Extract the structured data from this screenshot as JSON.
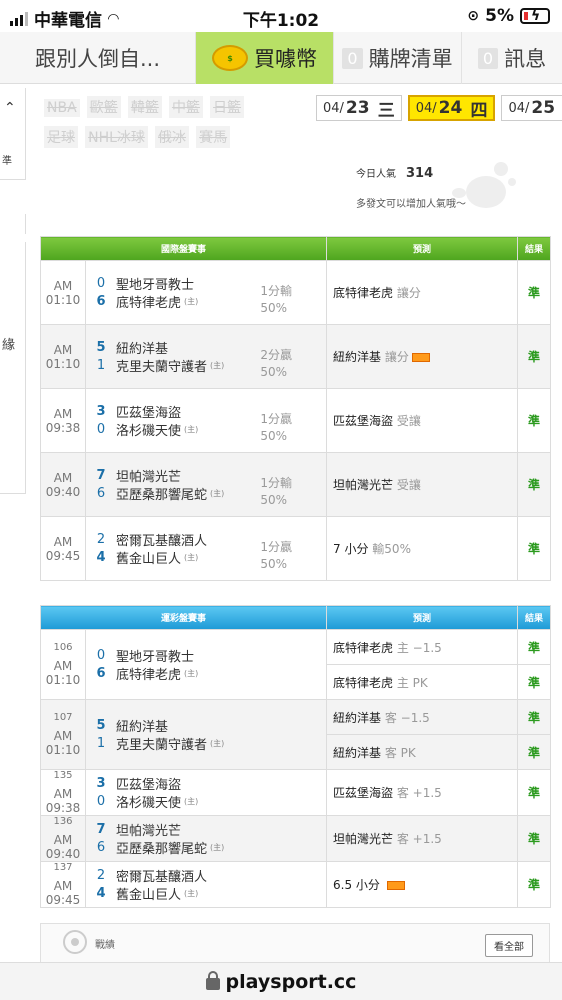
{
  "status": {
    "carrier": "中華電信",
    "time": "下午1:02",
    "battery": "5%"
  },
  "topnav": [
    {
      "label": "跟別人倒自...",
      "count": ""
    },
    {
      "label": "買噱幣",
      "count": ""
    },
    {
      "label": "購牌清單",
      "count": "0"
    },
    {
      "label": "訊息",
      "count": "0"
    }
  ],
  "rail": {
    "label1": "準",
    "label2": "緣"
  },
  "leagues": [
    "NBA",
    "歐籃",
    "韓籃",
    "中籃",
    "日籃",
    "足球",
    "NHL冰球",
    "俄冰",
    "賽馬"
  ],
  "dates": [
    {
      "md": "04/",
      "day": "23",
      "wd": "三",
      "active": false
    },
    {
      "md": "04/",
      "day": "24",
      "wd": "四",
      "active": true
    },
    {
      "md": "04/",
      "day": "25",
      "wd": "五",
      "active": false
    }
  ],
  "popularity": {
    "label": "今日人氣",
    "value": "314",
    "hint": "多發文可以增加人氣哦～"
  },
  "intl": {
    "headers": [
      "國際盤賽事",
      "預測",
      "結果"
    ],
    "rows": [
      {
        "time": "AM 01:10",
        "s1": "0",
        "t1": "聖地牙哥教士",
        "s2": "6",
        "t2": "底特律老虎",
        "home": "(主)",
        "odds1": "1分輸",
        "odds2": "50%",
        "pred": "底特律老虎",
        "pred_sub": "讓分",
        "res": "準"
      },
      {
        "time": "AM 01:10",
        "s1": "5",
        "t1": "紐約洋基",
        "s2": "1",
        "t2": "克里夫蘭守護者",
        "home": "(主)",
        "odds1": "2分贏",
        "odds2": "50%",
        "pred": "紐約洋基",
        "pred_sub": "讓分",
        "res": "準"
      },
      {
        "time": "AM 09:38",
        "s1": "3",
        "t1": "匹茲堡海盜",
        "s2": "0",
        "t2": "洛杉磯天使",
        "home": "(主)",
        "odds1": "1分贏",
        "odds2": "50%",
        "pred": "匹茲堡海盜",
        "pred_sub": "受讓",
        "res": "準"
      },
      {
        "time": "AM 09:40",
        "s1": "7",
        "t1": "坦帕灣光芒",
        "s2": "6",
        "t2": "亞歷桑那響尾蛇",
        "home": "(主)",
        "odds1": "1分輸",
        "odds2": "50%",
        "pred": "坦帕灣光芒",
        "pred_sub": "受讓",
        "res": "準"
      },
      {
        "time": "AM 09:45",
        "s1": "2",
        "t1": "密爾瓦基釀酒人",
        "s2": "4",
        "t2": "舊金山巨人",
        "home": "(主)",
        "odds1": "1分贏",
        "odds2": "50%",
        "pred": "7 小分",
        "pred_sub": "輸50%",
        "res": "準"
      }
    ]
  },
  "lottery": {
    "headers": [
      "運彩盤賽事",
      "預測",
      "結果"
    ],
    "rows": [
      {
        "code": "106",
        "time": "AM 01:10",
        "s1": "0",
        "t1": "聖地牙哥教士",
        "s2": "6",
        "t2": "底特律老虎",
        "home": "(主)",
        "preds": [
          {
            "pred": "底特律老虎",
            "sub": "主 −1.5",
            "res": "準"
          },
          {
            "pred": "底特律老虎",
            "sub": "主 PK",
            "res": "準"
          }
        ]
      },
      {
        "code": "107",
        "time": "AM 01:10",
        "s1": "5",
        "t1": "紐約洋基",
        "s2": "1",
        "t2": "克里夫蘭守護者",
        "home": "(主)",
        "preds": [
          {
            "pred": "紐約洋基",
            "sub": "客 −1.5",
            "res": "準"
          },
          {
            "pred": "紐約洋基",
            "sub": "客 PK",
            "res": "準"
          }
        ]
      },
      {
        "code": "135",
        "time": "AM 09:38",
        "s1": "3",
        "t1": "匹茲堡海盜",
        "s2": "0",
        "t2": "洛杉磯天使",
        "home": "(主)",
        "preds": [
          {
            "pred": "匹茲堡海盜",
            "sub": "客 +1.5",
            "res": "準"
          }
        ]
      },
      {
        "code": "136",
        "time": "AM 09:40",
        "s1": "7",
        "t1": "坦帕灣光芒",
        "s2": "6",
        "t2": "亞歷桑那響尾蛇",
        "home": "(主)",
        "preds": [
          {
            "pred": "坦帕灣光芒",
            "sub": "客 +1.5",
            "res": "準"
          }
        ]
      },
      {
        "code": "137",
        "time": "AM 09:45",
        "s1": "2",
        "t1": "密爾瓦基釀酒人",
        "s2": "4",
        "t2": "舊金山巨人",
        "home": "(主)",
        "preds": [
          {
            "pred": "6.5 小分",
            "sub": "",
            "res": "準"
          }
        ]
      }
    ]
  },
  "record": {
    "label": "戰績",
    "all_button": "看全部"
  },
  "url": "playsport.cc",
  "colors": {
    "green_header": "#5bb12a",
    "blue_header": "#2aa4de",
    "active_tab": "#b8e066",
    "active_date": "#ffe600",
    "result": "#2b9a1e"
  }
}
